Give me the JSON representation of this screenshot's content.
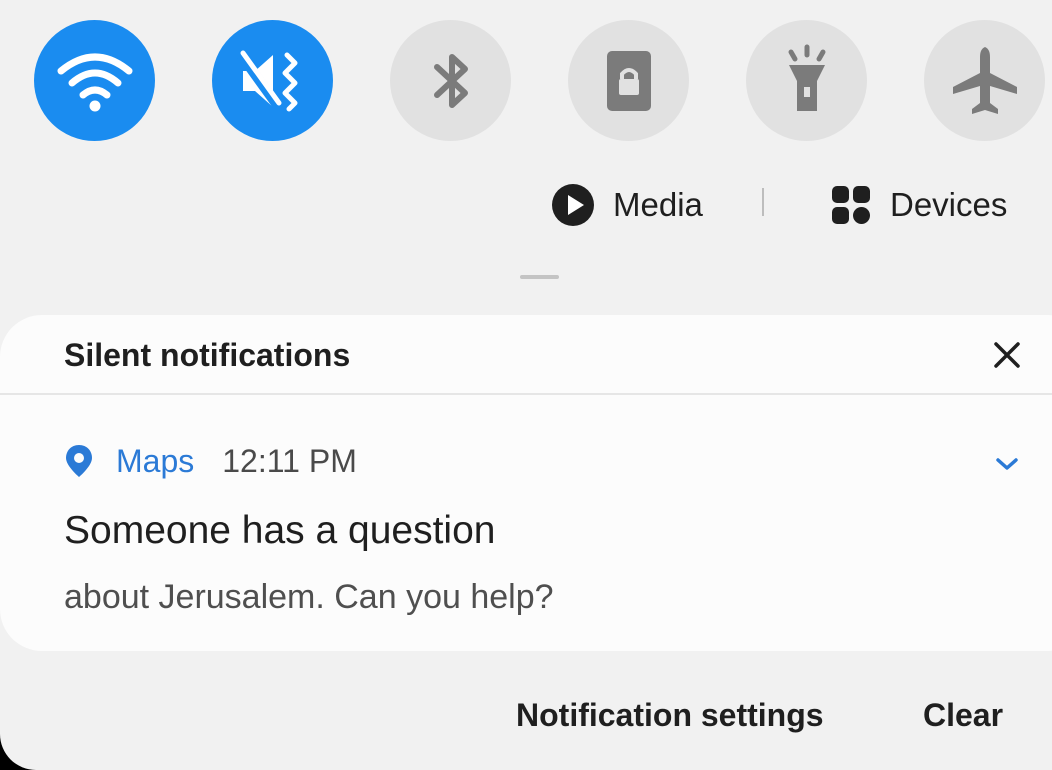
{
  "quick_settings": [
    {
      "icon": "wifi-icon",
      "state": "on",
      "color": "#1a8cf0"
    },
    {
      "icon": "vibrate-mode-icon",
      "state": "on",
      "color": "#1a8cf0"
    },
    {
      "icon": "bluetooth-icon",
      "state": "off"
    },
    {
      "icon": "screen-lock-icon",
      "state": "off"
    },
    {
      "icon": "flashlight-icon",
      "state": "off"
    },
    {
      "icon": "airplane-mode-icon",
      "state": "off"
    }
  ],
  "media_row": {
    "media_label": "Media",
    "media_icon": "play-circle-icon",
    "devices_label": "Devices",
    "devices_icon": "devices-grid-icon"
  },
  "silent_section": {
    "title": "Silent notifications",
    "close_icon": "close-icon"
  },
  "notification": {
    "app_icon": "map-pin-icon",
    "app_name": "Maps",
    "app_color": "#2b7ad6",
    "time": "12:11 PM",
    "title": "Someone has a question",
    "body": "about Jerusalem. Can you help?",
    "expand_icon": "chevron-down-icon"
  },
  "footer": {
    "settings_label": "Notification settings",
    "clear_label": "Clear"
  }
}
